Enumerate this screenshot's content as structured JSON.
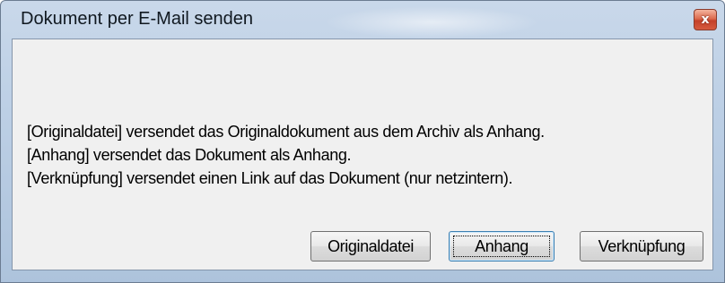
{
  "window": {
    "title": "Dokument per E-Mail senden",
    "close_glyph": "x",
    "close_icon": "close-icon"
  },
  "message": {
    "lines": [
      "[Originaldatei] versendet das Originaldokument aus dem Archiv als Anhang.",
      "[Anhang] versendet das Dokument als Anhang.",
      "[Verknüpfung] versendet einen Link auf das Dokument (nur netzintern)."
    ]
  },
  "buttons": {
    "original": "Originaldatei",
    "attachment": "Anhang",
    "link": "Verknüpfung"
  },
  "colors": {
    "frame": "#bccfe5",
    "client": "#f0f0f0",
    "close_button": "#c4412a",
    "default_button_border": "#3c7fb1"
  }
}
